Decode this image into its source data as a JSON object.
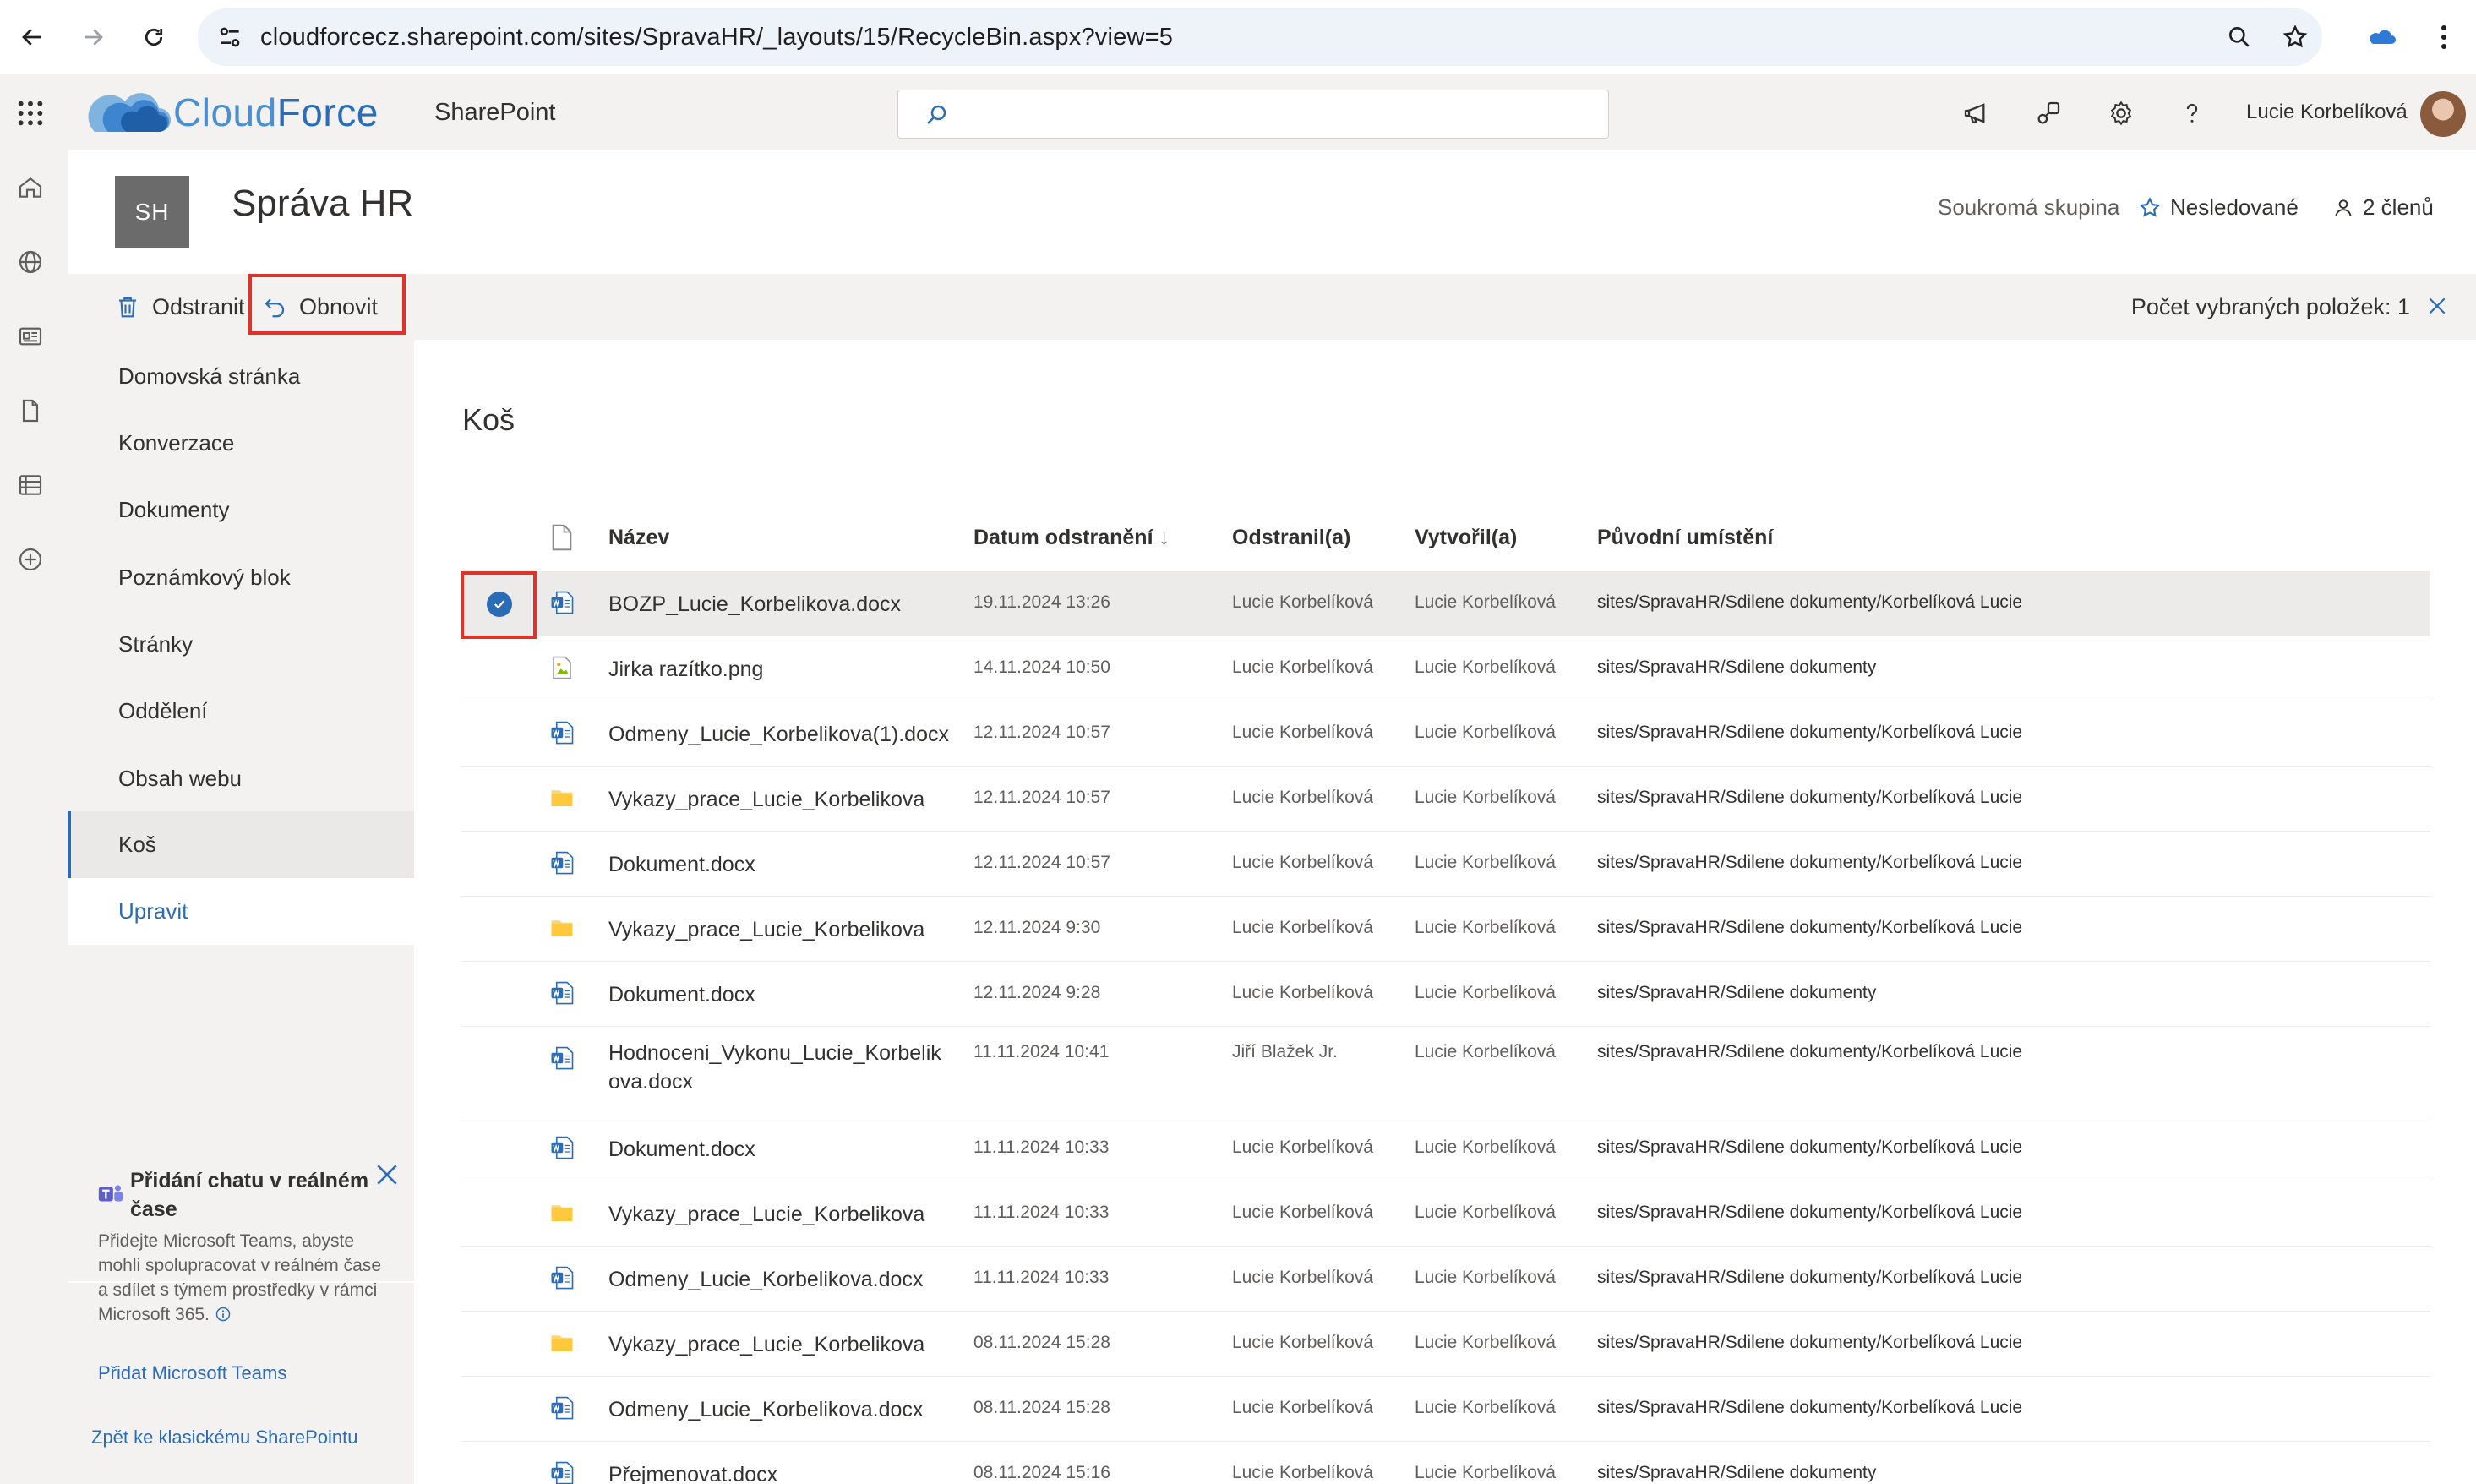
{
  "browser": {
    "url": "cloudforcecz.sharepoint.com/sites/SpravaHR/_layouts/15/RecycleBin.aspx?view=5"
  },
  "suite": {
    "brand_part1": "Cloud",
    "brand_part2": "Force",
    "app_name": "SharePoint",
    "search_placeholder": "",
    "user_name": "Lucie Korbelíková",
    "brand_color": "#2b6cb7"
  },
  "site": {
    "logo_initials": "SH",
    "title": "Správa HR",
    "privacy": "Soukromá skupina",
    "follow_label": "Nesledované",
    "members_label": "2 členů"
  },
  "commands": {
    "delete_label": "Odstranit",
    "restore_label": "Obnovit",
    "selected_count": "Počet vybraných položek: 1"
  },
  "nav": {
    "items": [
      {
        "label": "Domovská stránka"
      },
      {
        "label": "Konverzace"
      },
      {
        "label": "Dokumenty"
      },
      {
        "label": "Poznámkový blok"
      },
      {
        "label": "Stránky"
      },
      {
        "label": "Oddělení"
      },
      {
        "label": "Obsah webu"
      },
      {
        "label": "Koš"
      }
    ],
    "edit_label": "Upravit",
    "teams_card": {
      "title": "Přidání chatu v reálném čase",
      "body": "Přidejte Microsoft Teams, abyste mohli spolupracovat v reálném čase a sdílet s týmem prostředky v rámci Microsoft 365.",
      "link": "Přidat Microsoft Teams"
    },
    "classic_link": "Zpět ke klasickému SharePointu"
  },
  "main": {
    "heading": "Koš",
    "columns": {
      "name": "Název",
      "deleted": "Datum odstranění",
      "deleted_sort": "↓",
      "deleted_by": "Odstranil(a)",
      "created_by": "Vytvořil(a)",
      "location": "Původní umístění"
    },
    "rows": [
      {
        "type": "word",
        "name": "BOZP_Lucie_Korbelikova.docx",
        "deleted": "19.11.2024 13:26",
        "deleted_by": "Lucie Korbelíková",
        "created_by": "Lucie Korbelíková",
        "location": "sites/SpravaHR/Sdilene dokumenty/Korbelíková Lucie",
        "selected": true
      },
      {
        "type": "image",
        "name": "Jirka razítko.png",
        "deleted": "14.11.2024 10:50",
        "deleted_by": "Lucie Korbelíková",
        "created_by": "Lucie Korbelíková",
        "location": "sites/SpravaHR/Sdilene dokumenty"
      },
      {
        "type": "word",
        "name": "Odmeny_Lucie_Korbelikova(1).docx",
        "deleted": "12.11.2024 10:57",
        "deleted_by": "Lucie Korbelíková",
        "created_by": "Lucie Korbelíková",
        "location": "sites/SpravaHR/Sdilene dokumenty/Korbelíková Lucie"
      },
      {
        "type": "folder",
        "name": "Vykazy_prace_Lucie_Korbelikova",
        "deleted": "12.11.2024 10:57",
        "deleted_by": "Lucie Korbelíková",
        "created_by": "Lucie Korbelíková",
        "location": "sites/SpravaHR/Sdilene dokumenty/Korbelíková Lucie"
      },
      {
        "type": "word",
        "name": "Dokument.docx",
        "deleted": "12.11.2024 10:57",
        "deleted_by": "Lucie Korbelíková",
        "created_by": "Lucie Korbelíková",
        "location": "sites/SpravaHR/Sdilene dokumenty/Korbelíková Lucie"
      },
      {
        "type": "folder",
        "name": "Vykazy_prace_Lucie_Korbelikova",
        "deleted": "12.11.2024 9:30",
        "deleted_by": "Lucie Korbelíková",
        "created_by": "Lucie Korbelíková",
        "location": "sites/SpravaHR/Sdilene dokumenty/Korbelíková Lucie"
      },
      {
        "type": "word",
        "name": "Dokument.docx",
        "deleted": "12.11.2024 9:28",
        "deleted_by": "Lucie Korbelíková",
        "created_by": "Lucie Korbelíková",
        "location": "sites/SpravaHR/Sdilene dokumenty"
      },
      {
        "type": "word",
        "name": "Hodnoceni_Vykonu_Lucie_Korbelikova.docx",
        "name_line1": "Hodnoceni_Vykonu_Lucie_Korbelik",
        "name_line2": "ova.docx",
        "deleted": "11.11.2024 10:41",
        "deleted_by": "Jiří Blažek Jr.",
        "created_by": "Lucie Korbelíková",
        "location": "sites/SpravaHR/Sdilene dokumenty/Korbelíková Lucie",
        "tall": true
      },
      {
        "type": "word",
        "name": "Dokument.docx",
        "deleted": "11.11.2024 10:33",
        "deleted_by": "Lucie Korbelíková",
        "created_by": "Lucie Korbelíková",
        "location": "sites/SpravaHR/Sdilene dokumenty/Korbelíková Lucie"
      },
      {
        "type": "folder",
        "name": "Vykazy_prace_Lucie_Korbelikova",
        "deleted": "11.11.2024 10:33",
        "deleted_by": "Lucie Korbelíková",
        "created_by": "Lucie Korbelíková",
        "location": "sites/SpravaHR/Sdilene dokumenty/Korbelíková Lucie"
      },
      {
        "type": "word",
        "name": "Odmeny_Lucie_Korbelikova.docx",
        "deleted": "11.11.2024 10:33",
        "deleted_by": "Lucie Korbelíková",
        "created_by": "Lucie Korbelíková",
        "location": "sites/SpravaHR/Sdilene dokumenty/Korbelíková Lucie"
      },
      {
        "type": "folder",
        "name": "Vykazy_prace_Lucie_Korbelikova",
        "deleted": "08.11.2024 15:28",
        "deleted_by": "Lucie Korbelíková",
        "created_by": "Lucie Korbelíková",
        "location": "sites/SpravaHR/Sdilene dokumenty/Korbelíková Lucie"
      },
      {
        "type": "word",
        "name": "Odmeny_Lucie_Korbelikova.docx",
        "deleted": "08.11.2024 15:28",
        "deleted_by": "Lucie Korbelíková",
        "created_by": "Lucie Korbelíková",
        "location": "sites/SpravaHR/Sdilene dokumenty/Korbelíková Lucie"
      },
      {
        "type": "word",
        "name": "Přejmenovat.docx",
        "deleted": "08.11.2024 15:16",
        "deleted_by": "Lucie Korbelíková",
        "created_by": "Lucie Korbelíková",
        "location": "sites/SpravaHR/Sdilene dokumenty"
      }
    ]
  }
}
